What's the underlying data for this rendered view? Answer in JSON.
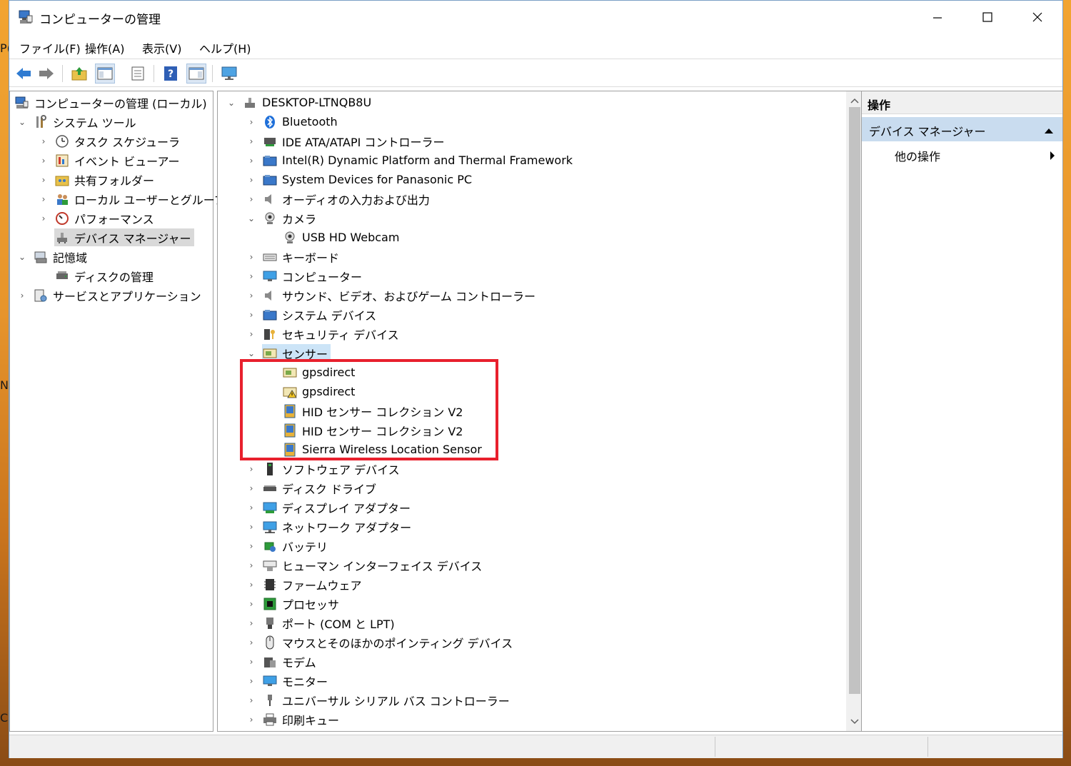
{
  "window": {
    "title": "コンピューターの管理"
  },
  "menu": [
    "ファイル(F)",
    "操作(A)",
    "表示(V)",
    "ヘルプ(H)"
  ],
  "left_tree": [
    {
      "label": "コンピューターの管理 (ローカル)",
      "icon": "computer-management-icon"
    },
    {
      "label": "システム ツール",
      "icon": "tools-icon"
    },
    {
      "label": "タスク スケジューラ",
      "icon": "clock-icon"
    },
    {
      "label": "イベント ビューアー",
      "icon": "event-viewer-icon"
    },
    {
      "label": "共有フォルダー",
      "icon": "shared-folder-icon"
    },
    {
      "label": "ローカル ユーザーとグループ",
      "icon": "users-icon"
    },
    {
      "label": "パフォーマンス",
      "icon": "performance-icon"
    },
    {
      "label": "デバイス マネージャー",
      "icon": "device-manager-icon"
    },
    {
      "label": "記憶域",
      "icon": "storage-icon"
    },
    {
      "label": "ディスクの管理",
      "icon": "disk-management-icon"
    },
    {
      "label": "サービスとアプリケーション",
      "icon": "services-icon"
    }
  ],
  "device_tree": {
    "root": "DESKTOP-LTNQB8U",
    "items": [
      "Bluetooth",
      "IDE ATA/ATAPI コントローラー",
      "Intel(R) Dynamic Platform and Thermal Framework",
      "System Devices for Panasonic PC",
      "オーディオの入力および出力",
      "カメラ",
      "USB HD Webcam",
      "キーボード",
      "コンピューター",
      "サウンド、ビデオ、およびゲーム コントローラー",
      "システム デバイス",
      "セキュリティ デバイス",
      "センサー",
      "gpsdirect",
      "gpsdirect",
      "HID センサー コレクション V2",
      "HID センサー コレクション V2",
      "Sierra Wireless Location Sensor",
      "ソフトウェア デバイス",
      "ディスク ドライブ",
      "ディスプレイ アダプター",
      "ネットワーク アダプター",
      "バッテリ",
      "ヒューマン インターフェイス デバイス",
      "ファームウェア",
      "プロセッサ",
      "ポート (COM と LPT)",
      "マウスとそのほかのポインティング デバイス",
      "モデム",
      "モニター",
      "ユニバーサル シリアル バス コントローラー",
      "印刷キュー"
    ]
  },
  "actions": {
    "header": "操作",
    "section": "デバイス マネージャー",
    "item": "他の操作"
  },
  "highlight_color": "#e8202d",
  "selection_color": "#cce4f7"
}
